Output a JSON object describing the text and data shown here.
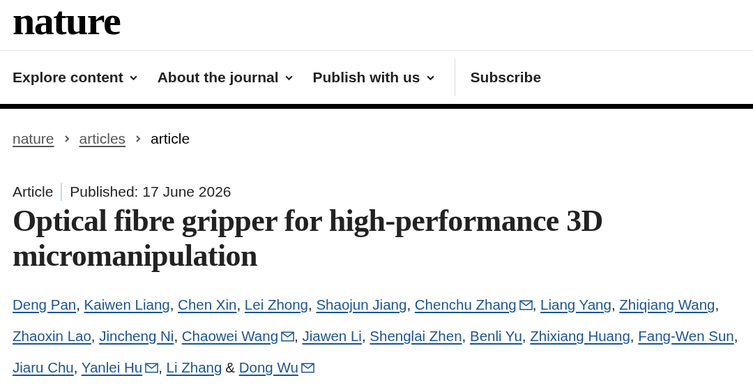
{
  "logo": "nature",
  "nav": [
    {
      "label": "Explore content",
      "dropdown": true
    },
    {
      "label": "About the journal",
      "dropdown": true
    },
    {
      "label": "Publish with us",
      "dropdown": true
    },
    {
      "label": "Subscribe",
      "dropdown": false
    }
  ],
  "breadcrumb": [
    {
      "label": "nature",
      "link": true
    },
    {
      "label": "articles",
      "link": true
    },
    {
      "label": "article",
      "link": false
    }
  ],
  "article_type": "Article",
  "published": "Published: 17 June 2026",
  "title": "Optical fibre gripper for high-performance 3D micromanipulation",
  "authors": [
    {
      "name": "Deng Pan",
      "email": false,
      "separator": ","
    },
    {
      "name": "Kaiwen Liang",
      "email": false,
      "separator": ","
    },
    {
      "name": "Chen Xin",
      "email": false,
      "separator": ","
    },
    {
      "name": "Lei Zhong",
      "email": false,
      "separator": ","
    },
    {
      "name": "Shaojun Jiang",
      "email": false,
      "separator": ","
    },
    {
      "name": "Chenchu Zhang",
      "email": true,
      "separator": ","
    },
    {
      "name": "Liang Yang",
      "email": false,
      "separator": ","
    },
    {
      "name": "Zhiqiang Wang",
      "email": false,
      "separator": ","
    },
    {
      "name": "Zhaoxin Lao",
      "email": false,
      "separator": ","
    },
    {
      "name": "Jincheng Ni",
      "email": false,
      "separator": ","
    },
    {
      "name": "Chaowei Wang",
      "email": true,
      "separator": ","
    },
    {
      "name": "Jiawen Li",
      "email": false,
      "separator": ","
    },
    {
      "name": "Shenglai Zhen",
      "email": false,
      "separator": ","
    },
    {
      "name": "Benli Yu",
      "email": false,
      "separator": ","
    },
    {
      "name": "Zhixiang Huang",
      "email": false,
      "separator": ","
    },
    {
      "name": "Fang-Wen Sun",
      "email": false,
      "separator": ","
    },
    {
      "name": "Jiaru Chu",
      "email": false,
      "separator": ","
    },
    {
      "name": "Yanlei Hu",
      "email": true,
      "separator": ","
    },
    {
      "name": "Li Zhang",
      "email": false,
      "separator": "&"
    },
    {
      "name": "Dong Wu",
      "email": true
    }
  ]
}
